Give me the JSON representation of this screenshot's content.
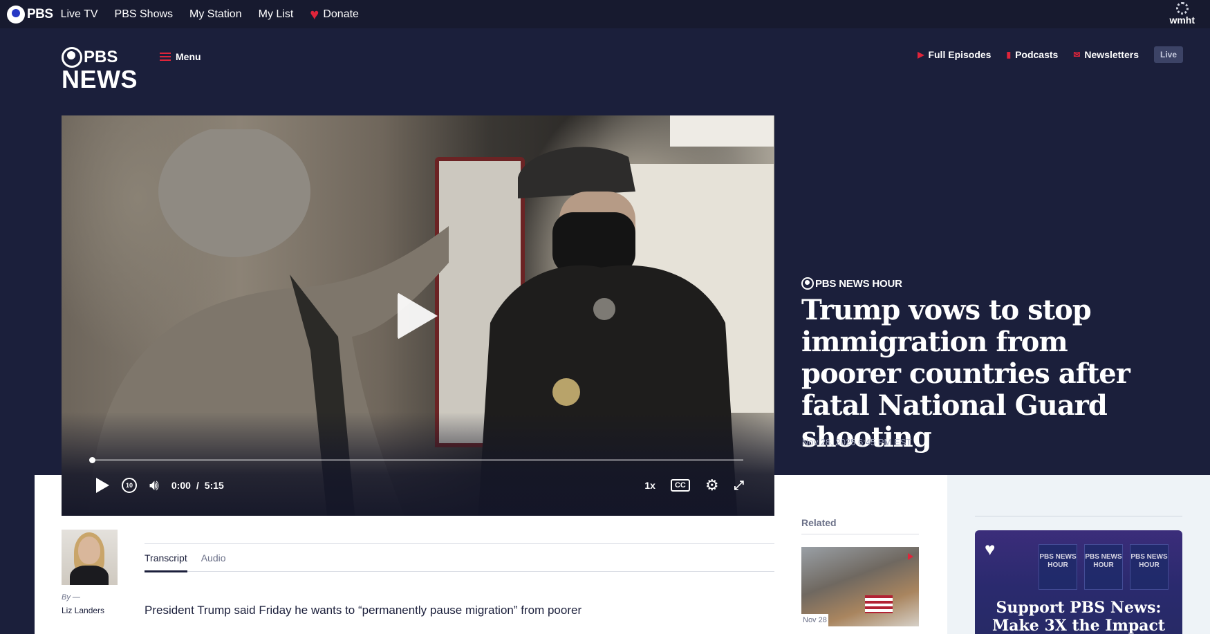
{
  "pbs_bar": {
    "logo": "PBS",
    "nav": [
      "Live TV",
      "PBS Shows",
      "My Station",
      "My List"
    ],
    "donate": "Donate",
    "station": "wmht"
  },
  "news_header": {
    "logo_top": "PBS",
    "logo_bottom": "NEWS",
    "menu": "Menu",
    "links": [
      {
        "label": "Full Episodes",
        "icon": "play-icon"
      },
      {
        "label": "Podcasts",
        "icon": "bars-icon"
      },
      {
        "label": "Newsletters",
        "icon": "mail-icon"
      }
    ],
    "live": "Live"
  },
  "video": {
    "current_time": "0:00",
    "separator": "/",
    "duration": "5:15",
    "progress": 0,
    "speed": "1x",
    "cc": "CC",
    "rewind_seconds": "10"
  },
  "article": {
    "show": "PBS NEWS HOUR",
    "headline": "Trump vows to stop immigration from poorer countries after fatal National Guard shooting",
    "date": "Nov 28, 2025 6:45 PM EST",
    "by_label": "By —",
    "author": "Liz Landers",
    "tabs": [
      "Transcript",
      "Audio"
    ],
    "active_tab": "Transcript",
    "body_first_line": "President Trump said Friday he wants to “permanently pause migration” from poorer"
  },
  "related": {
    "title": "Related",
    "date": "Nov 28"
  },
  "promo": {
    "screen_text": "PBS NEWS HOUR",
    "text": "Support PBS News: Make 3X the Impact"
  },
  "colors": {
    "navy": "#1b1f3b",
    "top_bar": "#171a2f",
    "accent_red": "#e0243a",
    "muted": "#a4a9c0"
  }
}
